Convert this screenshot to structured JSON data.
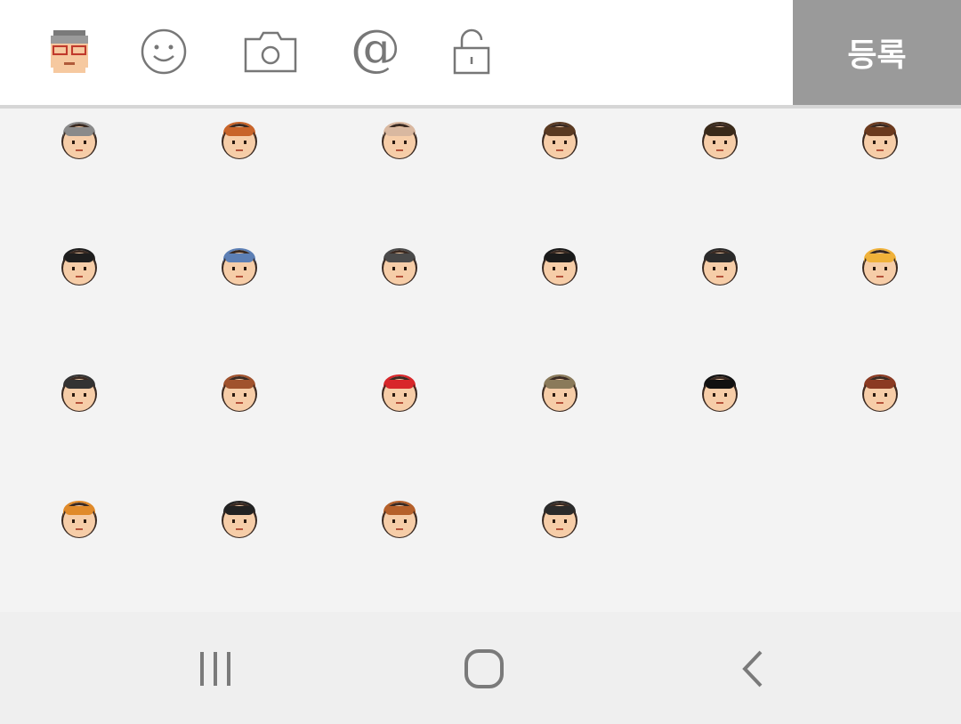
{
  "toolbar": {
    "icons": [
      "user-avatar-icon",
      "emoji-icon",
      "camera-icon",
      "mention-icon",
      "lock-icon"
    ],
    "submit_label": "등록",
    "submit_color": "#9a9a9a"
  },
  "emoticons": {
    "rows": 4,
    "columns": 6,
    "faces": [
      {
        "name": "gray-hair-glasses-face",
        "hair": "#8a8a8a"
      },
      {
        "name": "orange-spiky-hair-face",
        "hair": "#c8642a"
      },
      {
        "name": "bald-elder-face",
        "hair": "#d9b8a0"
      },
      {
        "name": "spiky-brown-hair-face",
        "hair": "#5a3a22"
      },
      {
        "name": "sunglasses-face",
        "hair": "#3a2a1a"
      },
      {
        "name": "brown-curly-hair-face",
        "hair": "#6b3a1e"
      },
      {
        "name": "black-hair-open-mouth-face",
        "hair": "#1e1e1e"
      },
      {
        "name": "blue-cap-elder-face",
        "hair": "#5c7fb5"
      },
      {
        "name": "gray-side-part-face",
        "hair": "#4a4a4a"
      },
      {
        "name": "dark-afro-sunglasses-face",
        "hair": "#1a1a1a"
      },
      {
        "name": "crying-black-hair-face",
        "hair": "#2a2a2a"
      },
      {
        "name": "blonde-girl-face",
        "hair": "#f0b23a"
      },
      {
        "name": "glasses-black-hair-face",
        "hair": "#333333"
      },
      {
        "name": "long-brown-hair-girl-face",
        "hair": "#a0522d"
      },
      {
        "name": "red-mushroom-cap-face",
        "hair": "#d8262a"
      },
      {
        "name": "gold-headband-face",
        "hair": "#8a7a5a"
      },
      {
        "name": "red-bow-black-hair-face",
        "hair": "#111111"
      },
      {
        "name": "brown-pigtails-face",
        "hair": "#8b3a22"
      },
      {
        "name": "blue-cap-long-hair-girl-face",
        "hair": "#e08a2a"
      },
      {
        "name": "red-ribbon-long-black-hair-face",
        "hair": "#222222"
      },
      {
        "name": "sunglasses-brown-hair-face",
        "hair": "#b5602a"
      },
      {
        "name": "crying-long-black-hair-face",
        "hair": "#2a2a2a"
      }
    ]
  },
  "navbar": {
    "buttons": [
      "recent-apps-icon",
      "home-icon",
      "back-icon"
    ]
  }
}
